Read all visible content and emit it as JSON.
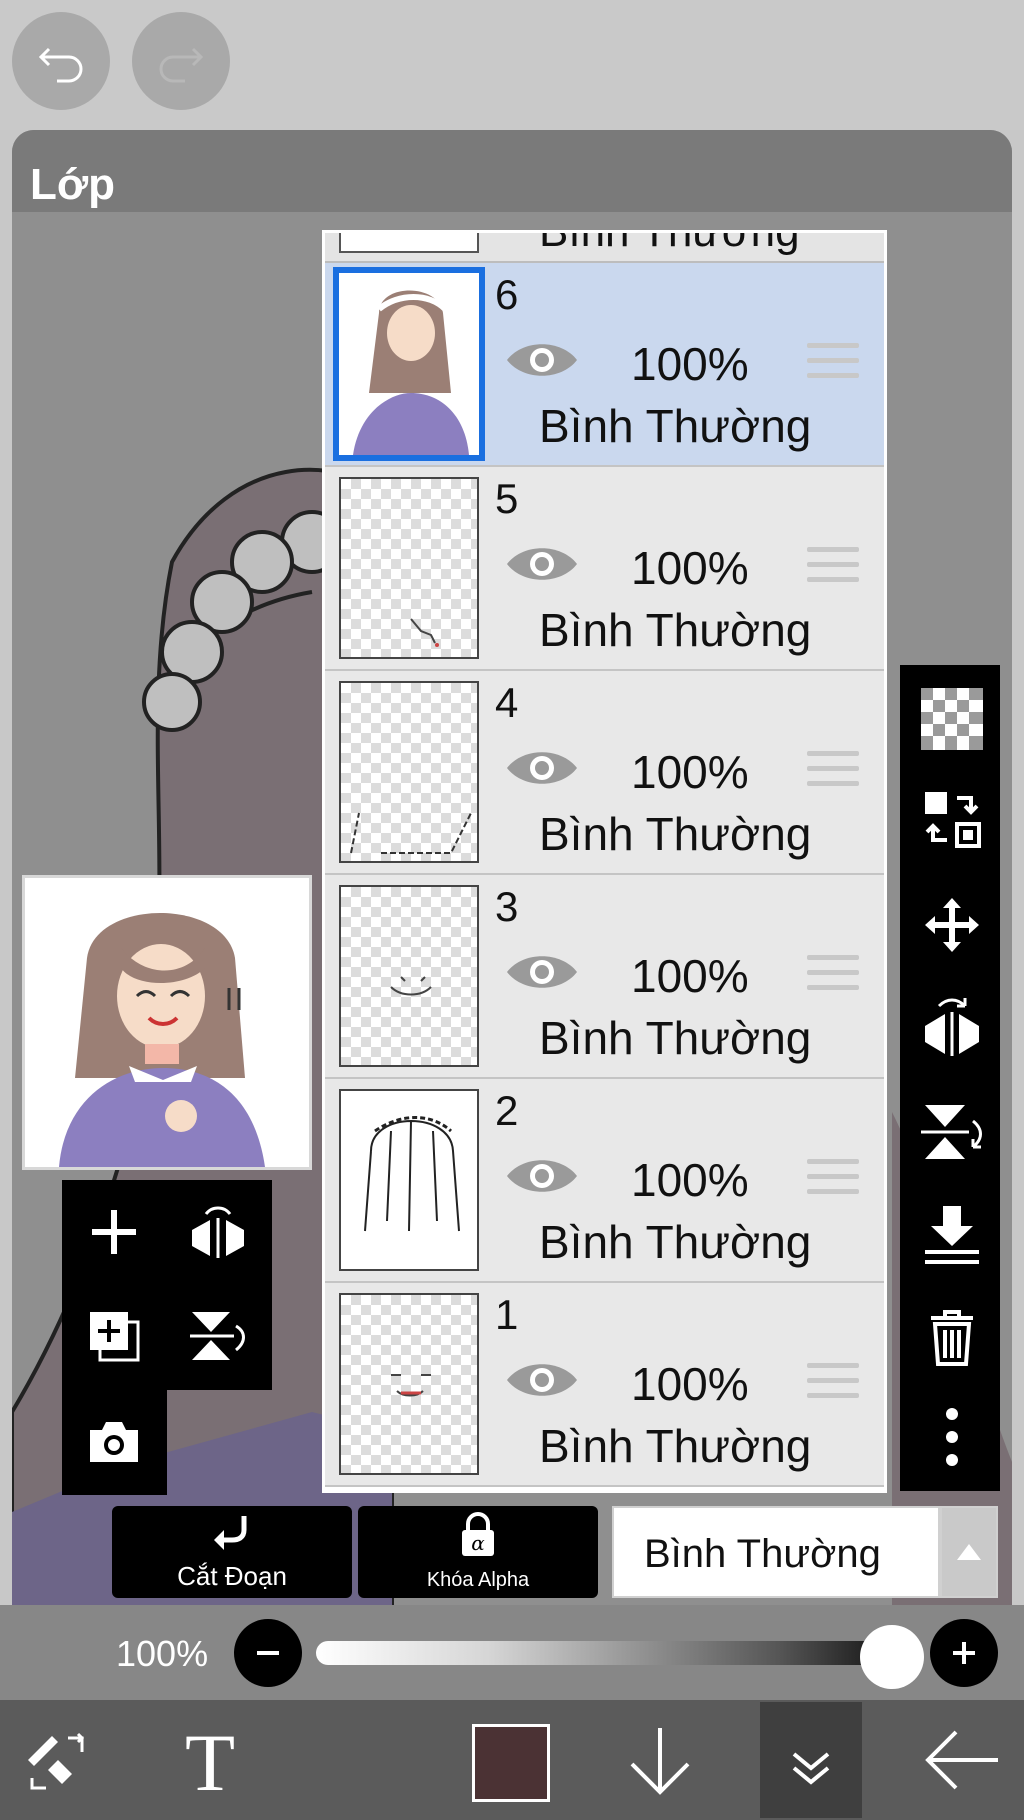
{
  "panel": {
    "title": "Lớp"
  },
  "layers": [
    {
      "number": "6",
      "opacity": "100%",
      "blend": "Bình Thường",
      "selected": true
    },
    {
      "number": "5",
      "opacity": "100%",
      "blend": "Bình Thường",
      "selected": false
    },
    {
      "number": "4",
      "opacity": "100%",
      "blend": "Bình Thường",
      "selected": false
    },
    {
      "number": "3",
      "opacity": "100%",
      "blend": "Bình Thường",
      "selected": false
    },
    {
      "number": "2",
      "opacity": "100%",
      "blend": "Bình Thường",
      "selected": false
    },
    {
      "number": "1",
      "opacity": "100%",
      "blend": "Bình Thường",
      "selected": false
    }
  ],
  "top_stub_blend": "Bình Thường",
  "actions": {
    "clipping_label": "Cắt Đoạn",
    "alpha_lock_label": "Khóa Alpha",
    "blend_mode": "Bình Thường"
  },
  "opacity_slider": {
    "label": "100%",
    "value": 1.0
  },
  "colors": {
    "selected_layer_bg": "#cad8ee",
    "selected_thumb_border": "#1a6fe0",
    "current_color": "#4b3234"
  },
  "icons": {
    "undo": "undo-icon",
    "redo": "redo-icon",
    "eye": "eye-icon",
    "drag": "drag-handle-icon",
    "transparent": "transparency-icon",
    "swap": "swap-layer-icon",
    "move": "move-icon",
    "flip_h": "flip-horizontal-icon",
    "flip_v": "flip-vertical-icon",
    "merge_down": "merge-down-icon",
    "trash": "trash-icon",
    "more": "more-icon",
    "add": "add-layer-icon",
    "copy": "duplicate-layer-icon",
    "camera": "camera-icon",
    "tool_swap": "brush-eraser-icon",
    "text": "text-icon",
    "down": "arrow-down-icon",
    "collapse": "double-chevron-down-icon",
    "back": "back-arrow-icon"
  }
}
